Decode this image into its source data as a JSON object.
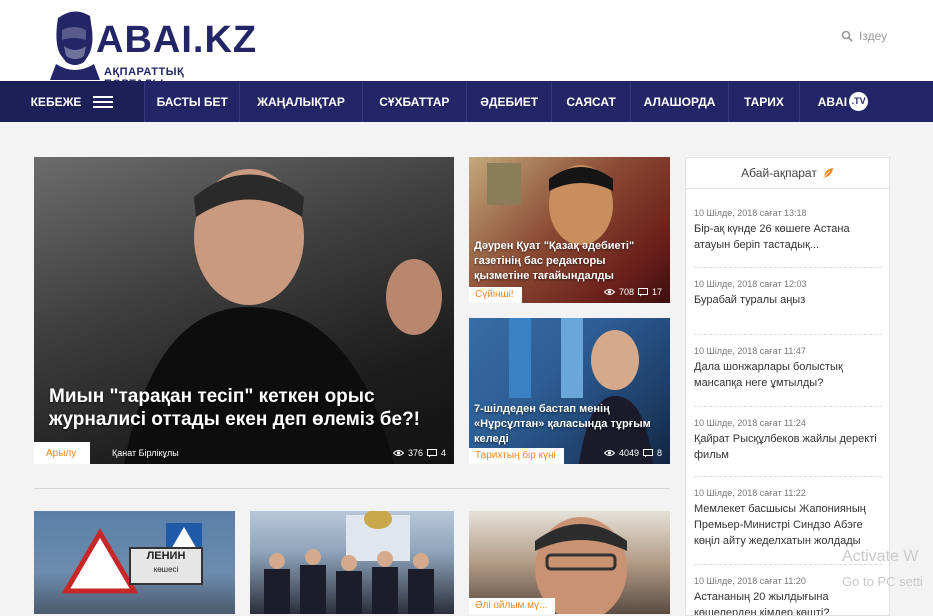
{
  "header": {
    "logo_text": "ABAI.KZ",
    "logo_subtitle": "АҚПАРАТТЫҚ ПОРТАЛЫ",
    "search_label": "Іздеу"
  },
  "nav": {
    "menu_label": "КЕБЕЖЕ",
    "items": [
      "БАСТЫ БЕТ",
      "ЖАҢАЛЫҚТАР",
      "СҰХБАТТАР",
      "ӘДЕБИЕТ",
      "САЯСАТ",
      "АЛАШОРДА",
      "ТАРИХ"
    ],
    "tv_label": "ABAI",
    "tv_badge": ".TV"
  },
  "main_story": {
    "title": "Миын \"тарақан тесіп\" кеткен орыс журналисі оттады екен деп өлеміз бе?!",
    "category": "Арылу",
    "author": "Қанат Бірлікұлы",
    "views": "376",
    "comments": "4"
  },
  "side_stories": [
    {
      "title": "Дәурен Қуат \"Қазақ әдебиеті\" газетінің бас редакторы қызметіне тағайындалды",
      "category": "Сүйінші!",
      "views": "708",
      "comments": "17"
    },
    {
      "title": "7-шілдеден бастап менің «Нұрсұлтан» қаласында тұрғым келеді",
      "category": "Тарихтың бір күні",
      "views": "4049",
      "comments": "8"
    }
  ],
  "thumbs": {
    "sign_main": "ЛЕНИН",
    "sign_sub": "көшесі",
    "third_category": "Әлі ойлым мү..."
  },
  "sidebar": {
    "title": "Абай-ақпарат",
    "items": [
      {
        "date": "10 Шілде, 2018 сағат 13:18",
        "title": "Бір-ақ күнде 26 көшеге Астана атауын беріп тастадық..."
      },
      {
        "date": "10 Шілде, 2018 сағат 12:03",
        "title": "Бурабай туралы аңыз"
      },
      {
        "date": "10 Шілде, 2018 сағат 11:47",
        "title": "Дала шонжарлары болыстық мансапқа неге ұмтылды?"
      },
      {
        "date": "10 Шілде, 2018 сағат 11:24",
        "title": "Қайрат Рысқұлбеков жайлы деректі фильм"
      },
      {
        "date": "10 Шілде, 2018 сағат 11:22",
        "title": "Мемлекет басшысы Жапонияның Премьер-Министрі Синдзо Абэге көңіл айту жеделхатын жолдады"
      },
      {
        "date": "10 Шілде, 2018 сағат 11:20",
        "title": "Астананың 20 жылдығына көшелерден кімдер көшті?"
      }
    ]
  },
  "watermark": {
    "line1": "Activate W",
    "line2": "Go to PC setti"
  },
  "colors": {
    "brand": "#232566",
    "accent": "#f0861e"
  }
}
